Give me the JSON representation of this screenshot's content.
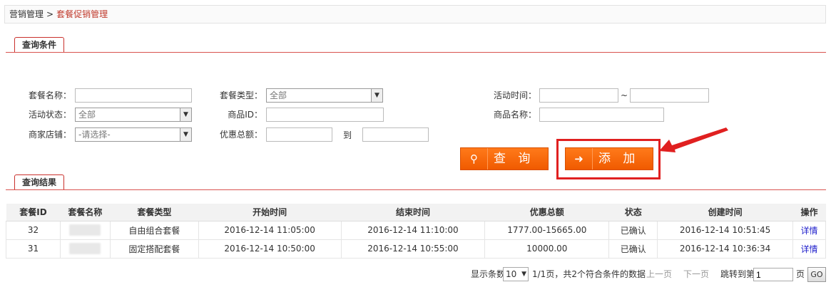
{
  "breadcrumb": {
    "root": "营销管理",
    "separator": ">",
    "current": "套餐促销管理"
  },
  "query_section": {
    "title": "查询条件"
  },
  "form": {
    "package_name_label": "套餐名称：",
    "package_name_value": "",
    "package_type_label": "套餐类型：",
    "package_type_value": "全部",
    "activity_time_label": "活动时间：",
    "activity_time_sep": "~",
    "activity_status_label": "活动状态：",
    "activity_status_value": "全部",
    "product_id_label": "商品ID：",
    "product_name_label": "商品名称：",
    "store_label": "商家店铺：",
    "store_value": "-请选择-",
    "discount_total_label": "优惠总额：",
    "discount_to_label": "到"
  },
  "buttons": {
    "query_label": "查 询",
    "add_label": "添 加"
  },
  "results_section": {
    "title": "查询结果"
  },
  "table": {
    "headers": [
      "套餐ID",
      "套餐名称",
      "套餐类型",
      "开始时间",
      "结束时间",
      "优惠总额",
      "状态",
      "创建时间",
      "操作"
    ],
    "rows": [
      {
        "id": "32",
        "type": "自由组合套餐",
        "start": "2016-12-14 11:05:00",
        "end": "2016-12-14 11:10:00",
        "discount": "1777.00-15665.00",
        "status": "已确认",
        "created": "2016-12-14 10:51:45",
        "action": "详情"
      },
      {
        "id": "31",
        "type": "固定搭配套餐",
        "start": "2016-12-14 10:50:00",
        "end": "2016-12-14 10:55:00",
        "discount": "10000.00",
        "status": "已确认",
        "created": "2016-12-14 10:36:34",
        "action": "详情"
      }
    ]
  },
  "pager": {
    "show_label": "显示条数",
    "page_size": "10",
    "summary": "1/1页，共2个符合条件的数据",
    "prev": "上一页",
    "next": "下一页",
    "jump_label": "跳转到第",
    "jump_value": "1",
    "page_unit": "页",
    "go_label": "GO"
  },
  "colors": {
    "accent": "#f05a00",
    "section_line": "#d9534f",
    "highlight": "#e02020",
    "link": "#2222cc"
  }
}
